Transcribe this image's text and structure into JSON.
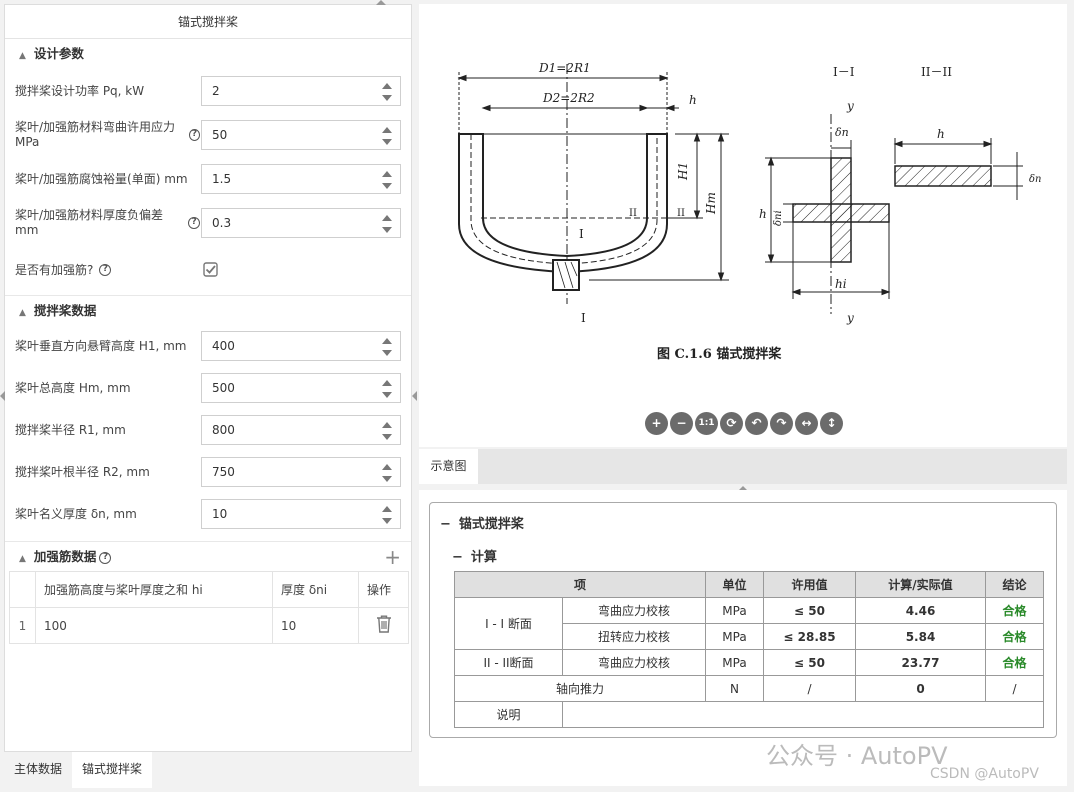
{
  "left_panel": {
    "title": "锚式搅拌桨",
    "design": {
      "header": "设计参数",
      "fields": [
        {
          "label": "搅拌桨设计功率 Pq, kW",
          "value": "2"
        },
        {
          "label": "桨叶/加强筋材料弯曲许用应力 MPa",
          "value": "50"
        },
        {
          "label": "桨叶/加强筋腐蚀裕量(单面) mm",
          "value": "1.5"
        },
        {
          "label": "桨叶/加强筋材料厚度负偏差 mm",
          "value": "0.3"
        }
      ],
      "rib_label": "是否有加强筋?"
    },
    "agitator": {
      "header": "搅拌桨数据",
      "fields": [
        {
          "label": "桨叶垂直方向悬臂高度 H1, mm",
          "value": "400"
        },
        {
          "label": "桨叶总高度 Hm, mm",
          "value": "500"
        },
        {
          "label": "搅拌桨半径 R1, mm",
          "value": "800"
        },
        {
          "label": "搅拌桨叶根半径 R2, mm",
          "value": "750"
        },
        {
          "label": "桨叶名义厚度 δn, mm",
          "value": "10"
        }
      ]
    },
    "rib": {
      "header": "加强筋数据",
      "columns": [
        "加强筋高度与桨叶厚度之和 hi",
        "厚度 δni",
        "操作"
      ],
      "rows": [
        {
          "index": "1",
          "height": "100",
          "thickness": "10"
        }
      ]
    }
  },
  "bottom_tabs": [
    "主体数据",
    "锚式搅拌桨"
  ],
  "figure": {
    "caption": "图 C.1.6   锚式搅拌桨",
    "labels": {
      "d1": "D1=2R1",
      "d2": "D2=2R2",
      "h": "h",
      "h1": "H1",
      "hm": "Hm",
      "sec1": "I－I",
      "sec2": "II－II",
      "y": "y",
      "dn": "δn",
      "dni": "δni",
      "hi": "hi",
      "db": "δn",
      "mark1": "I",
      "mark2": "II"
    }
  },
  "toolbar": [
    "+",
    "−",
    "1:1",
    "⟳",
    "↶",
    "↷",
    "↔",
    "↕"
  ],
  "diagram_tab": "示意图",
  "results": {
    "title": "锚式搅拌桨",
    "subtitle": "计算",
    "columns": [
      "项",
      "单位",
      "许用值",
      "计算/实际值",
      "结论"
    ],
    "rows": [
      {
        "group": "I - I 断面",
        "item": "弯曲应力校核",
        "unit": "MPa",
        "allow": "≤ 50",
        "value": "4.46",
        "result": "合格"
      },
      {
        "group": "",
        "item": "扭转应力校核",
        "unit": "MPa",
        "allow": "≤ 28.85",
        "value": "5.84",
        "result": "合格"
      },
      {
        "group": "II - II断面",
        "item": "弯曲应力校核",
        "unit": "MPa",
        "allow": "≤ 50",
        "value": "23.77",
        "result": "合格"
      }
    ],
    "axial": {
      "item": "轴向推力",
      "unit": "N",
      "allow": "/",
      "value": "0",
      "result": "/"
    },
    "note_label": "说明"
  },
  "watermark": {
    "main": "公众号 · AutoPV",
    "sub": "CSDN @AutoPV"
  },
  "colors": {
    "pass": "#2a8a2a",
    "header_bg": "#e0e0e0"
  }
}
